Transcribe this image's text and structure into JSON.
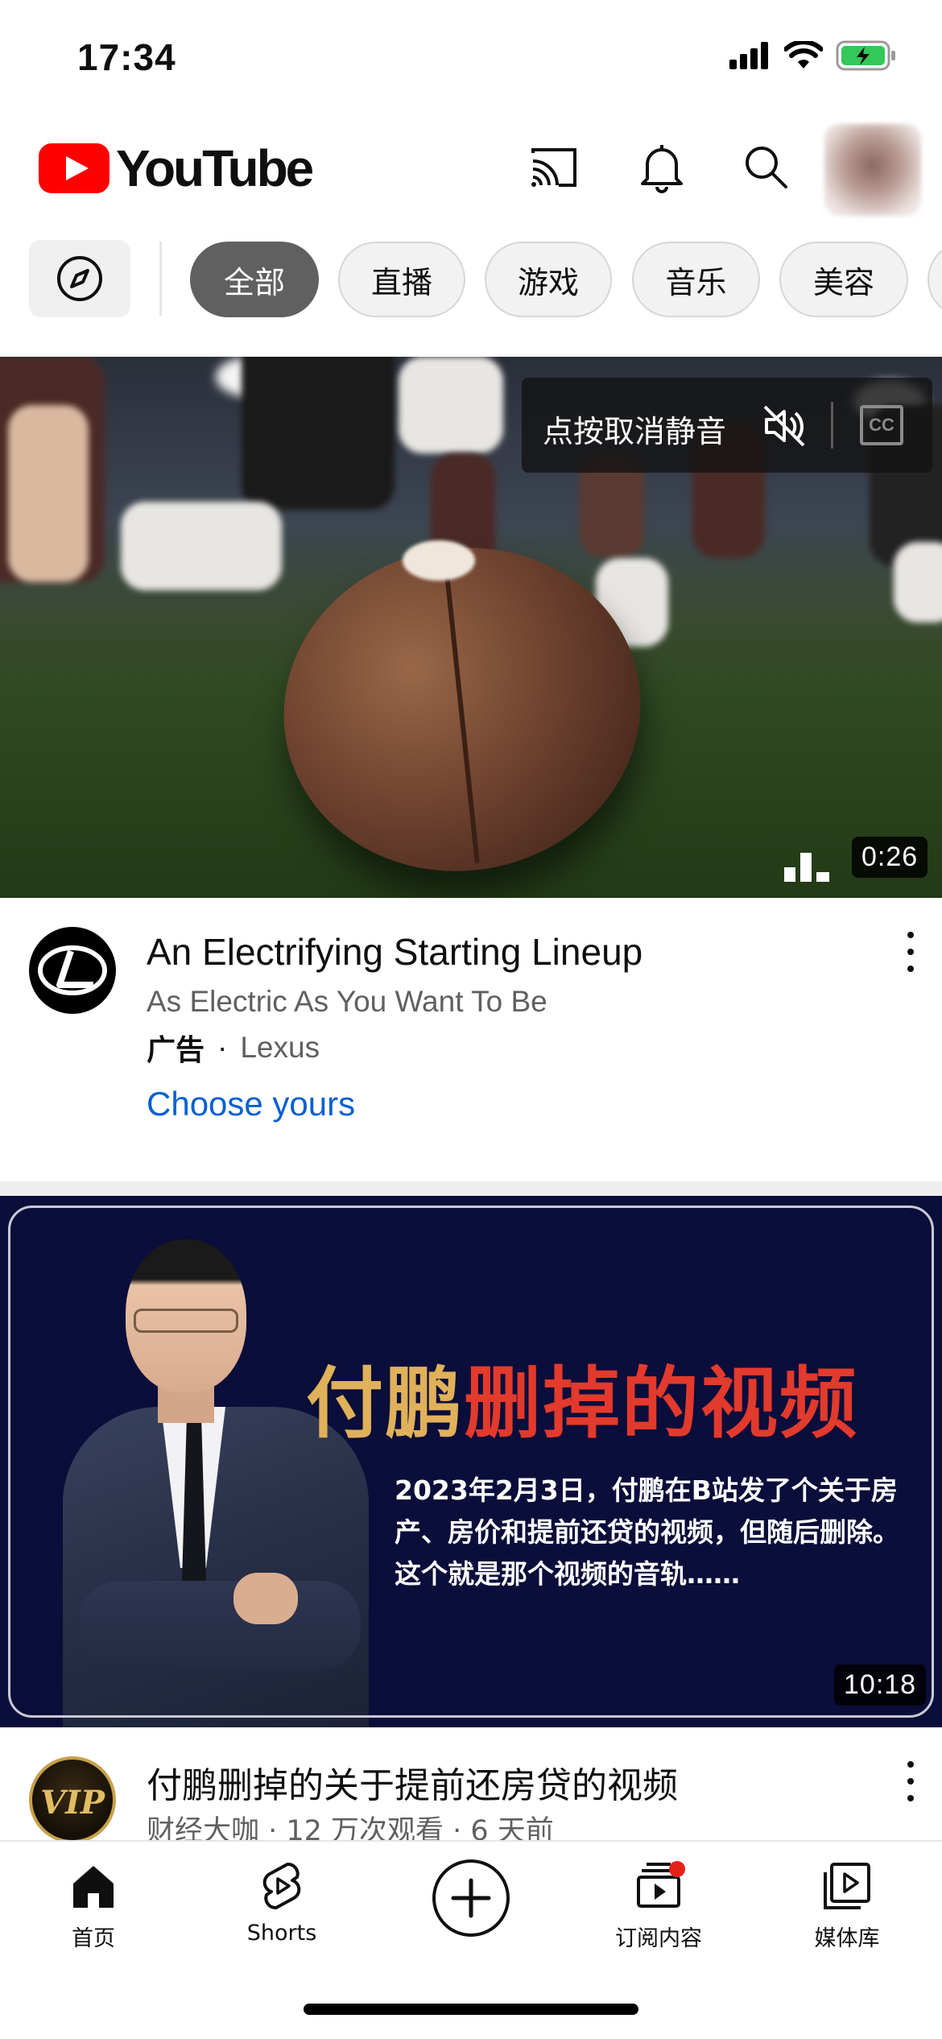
{
  "status_bar": {
    "time": "17:34"
  },
  "header": {
    "logo_text": "YouTube"
  },
  "chips": [
    {
      "label": "全部",
      "active": true
    },
    {
      "label": "直播",
      "active": false
    },
    {
      "label": "游戏",
      "active": false
    },
    {
      "label": "音乐",
      "active": false
    },
    {
      "label": "美容",
      "active": false
    }
  ],
  "ad_video": {
    "mute_banner_text": "点按取消静音",
    "cc_label": "CC",
    "duration": "0:26",
    "title": "An Electrifying Starting Lineup",
    "subtitle": "As Electric As You Want To Be",
    "ad_label": "广告",
    "separator": "·",
    "advertiser": "Lexus",
    "cta": "Choose yours"
  },
  "video2": {
    "thumb_title_part1": "付鹏",
    "thumb_title_part2": "删掉的视频",
    "thumb_desc": "2023年2月3日，付鹏在B站发了个关于房产、房价和提前还贷的视频，但随后删除。这个就是那个视频的音轨……",
    "duration": "10:18",
    "channel_badge": "VIP",
    "title": "付鹏删掉的关于提前还房贷的视频",
    "meta": "财经大咖 · 12 万次观看 · 6 天前"
  },
  "bottom_nav": {
    "home": "首页",
    "shorts": "Shorts",
    "subscriptions": "订阅内容",
    "library": "媒体库"
  },
  "colors": {
    "youtube_red": "#ff0000",
    "link_blue": "#065fd4",
    "chip_active": "#606060",
    "notification_dot": "#e62117",
    "battery_green": "#34c759"
  }
}
